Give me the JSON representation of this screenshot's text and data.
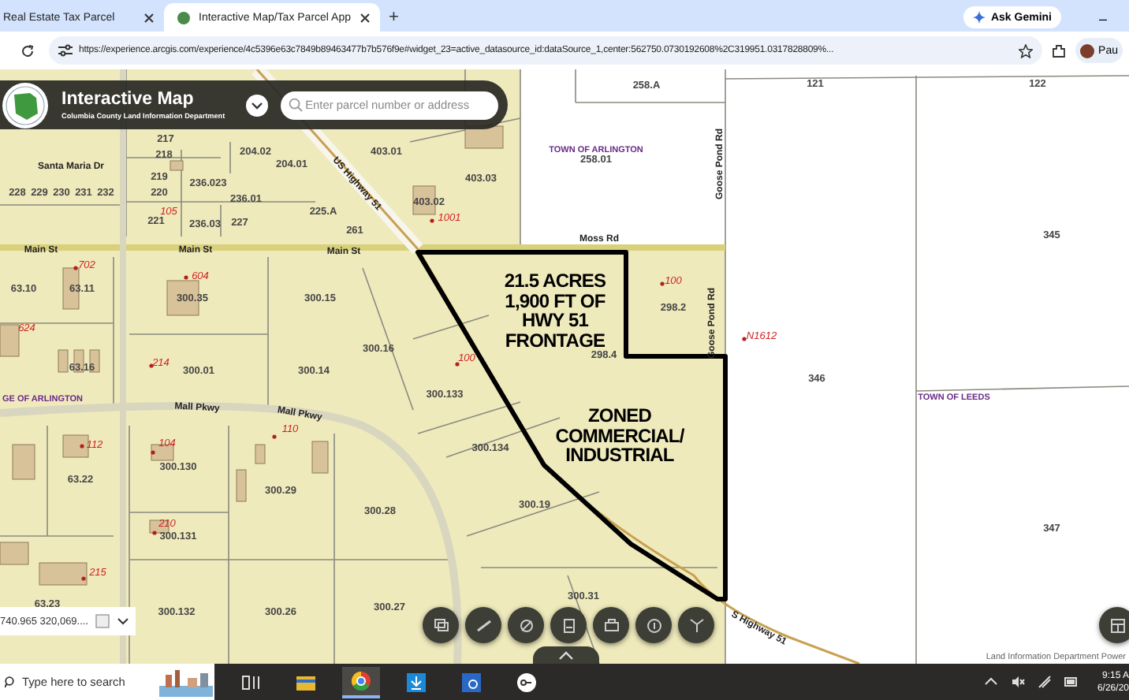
{
  "browser": {
    "tabs": [
      {
        "title": "Real Estate Tax Parcel",
        "selected": false
      },
      {
        "title": "Interactive Map/Tax Parcel App",
        "selected": true
      }
    ],
    "new_tab": "+",
    "gemini": "Ask Gemini",
    "minimize": "–",
    "url": "https://experience.arcgis.com/experience/4c5396e63c7849b89463477b7b576f9e#widget_23=active_datasource_id:dataSource_1,center:562750.0730192608%2C319951.0317828809%...",
    "profile": "Pau"
  },
  "app": {
    "title": "Interactive Map",
    "subtitle": "Columbia County Land Information Department",
    "search": {
      "placeholder": "Enter parcel number or address"
    }
  },
  "map": {
    "labels": [
      {
        "kind": "parcel",
        "text": "258.A"
      },
      {
        "kind": "parcel",
        "text": "121"
      },
      {
        "kind": "parcel",
        "text": "122"
      },
      {
        "kind": "town",
        "text": "TOWN OF ARLINGTON"
      },
      {
        "kind": "parcel",
        "text": "258.01"
      },
      {
        "kind": "parcel",
        "text": "345"
      },
      {
        "kind": "address",
        "text": "100"
      },
      {
        "kind": "parcel",
        "text": "298.2"
      },
      {
        "kind": "address",
        "text": "N1612"
      },
      {
        "kind": "parcel",
        "text": "346"
      },
      {
        "kind": "town",
        "text": "TOWN OF LEEDS"
      },
      {
        "kind": "parcel",
        "text": "347"
      },
      {
        "kind": "road",
        "text": "Goose Pond Rd"
      },
      {
        "kind": "road",
        "text": "Goose Pond Rd"
      },
      {
        "kind": "road",
        "text": "Moss Rd"
      },
      {
        "kind": "parcel",
        "text": "403.01"
      },
      {
        "kind": "parcel",
        "text": "403.03"
      },
      {
        "kind": "parcel",
        "text": "403.02"
      },
      {
        "kind": "address",
        "text": "1001"
      },
      {
        "kind": "parcel",
        "text": "217"
      },
      {
        "kind": "parcel",
        "text": "218"
      },
      {
        "kind": "parcel",
        "text": "204.02"
      },
      {
        "kind": "parcel",
        "text": "204.01"
      },
      {
        "kind": "parcel",
        "text": "236.023"
      },
      {
        "kind": "parcel",
        "text": "236.01"
      },
      {
        "kind": "parcel",
        "text": "219"
      },
      {
        "kind": "parcel",
        "text": "220"
      },
      {
        "kind": "parcel",
        "text": "221"
      },
      {
        "kind": "address",
        "text": "105"
      },
      {
        "kind": "parcel",
        "text": "236.03"
      },
      {
        "kind": "parcel",
        "text": "227"
      },
      {
        "kind": "parcel",
        "text": "225.A"
      },
      {
        "kind": "parcel",
        "text": "261"
      },
      {
        "kind": "road",
        "text": "Santa Maria Dr"
      },
      {
        "kind": "parcel",
        "text": "228"
      },
      {
        "kind": "parcel",
        "text": "229"
      },
      {
        "kind": "parcel",
        "text": "230"
      },
      {
        "kind": "parcel",
        "text": "231"
      },
      {
        "kind": "parcel",
        "text": "232"
      },
      {
        "kind": "road",
        "text": "US Highway 51"
      },
      {
        "kind": "road",
        "text": "Main St"
      },
      {
        "kind": "road",
        "text": "Main St"
      },
      {
        "kind": "road",
        "text": "Main St"
      },
      {
        "kind": "address",
        "text": "702"
      },
      {
        "kind": "address",
        "text": "604"
      },
      {
        "kind": "parcel",
        "text": "63.10"
      },
      {
        "kind": "parcel",
        "text": "63.11"
      },
      {
        "kind": "parcel",
        "text": "300.35"
      },
      {
        "kind": "parcel",
        "text": "300.15"
      },
      {
        "kind": "address",
        "text": "624"
      },
      {
        "kind": "parcel",
        "text": "300.16"
      },
      {
        "kind": "parcel",
        "text": "63.16"
      },
      {
        "kind": "address",
        "text": "214"
      },
      {
        "kind": "parcel",
        "text": "300.01"
      },
      {
        "kind": "parcel",
        "text": "300.14"
      },
      {
        "kind": "address",
        "text": "100"
      },
      {
        "kind": "parcel",
        "text": "300.133"
      },
      {
        "kind": "parcel",
        "text": "298.4"
      },
      {
        "kind": "town",
        "text": "GE OF ARLINGTON"
      },
      {
        "kind": "road",
        "text": "Mall Pkwy"
      },
      {
        "kind": "road",
        "text": "Mall Pkwy"
      },
      {
        "kind": "address",
        "text": "110"
      },
      {
        "kind": "address",
        "text": "112"
      },
      {
        "kind": "address",
        "text": "104"
      },
      {
        "kind": "parcel",
        "text": "300.134"
      },
      {
        "kind": "parcel",
        "text": "300.130"
      },
      {
        "kind": "parcel",
        "text": "300.29"
      },
      {
        "kind": "parcel",
        "text": "63.22"
      },
      {
        "kind": "parcel",
        "text": "300.28"
      },
      {
        "kind": "parcel",
        "text": "300.19"
      },
      {
        "kind": "address",
        "text": "210"
      },
      {
        "kind": "parcel",
        "text": "300.131"
      },
      {
        "kind": "address",
        "text": "215"
      },
      {
        "kind": "parcel",
        "text": "63.23"
      },
      {
        "kind": "parcel",
        "text": "300.132"
      },
      {
        "kind": "parcel",
        "text": "300.26"
      },
      {
        "kind": "parcel",
        "text": "300.27"
      },
      {
        "kind": "parcel",
        "text": "300.31"
      },
      {
        "kind": "road",
        "text": "S Highway 51"
      }
    ],
    "callouts": [
      {
        "lines": [
          "21.5 ACRES",
          "1,900 FT OF",
          "HWY 51",
          "FRONTAGE"
        ]
      },
      {
        "lines": [
          "ZONED",
          "COMMERCIAL/",
          "INDUSTRIAL"
        ]
      }
    ],
    "coordinates": "740.965 320,069....",
    "attribution": "Land Information Department  Power"
  },
  "taskbar": {
    "search_placeholder": "Type here to search",
    "time": "9:15 A",
    "date": "6/26/20"
  }
}
